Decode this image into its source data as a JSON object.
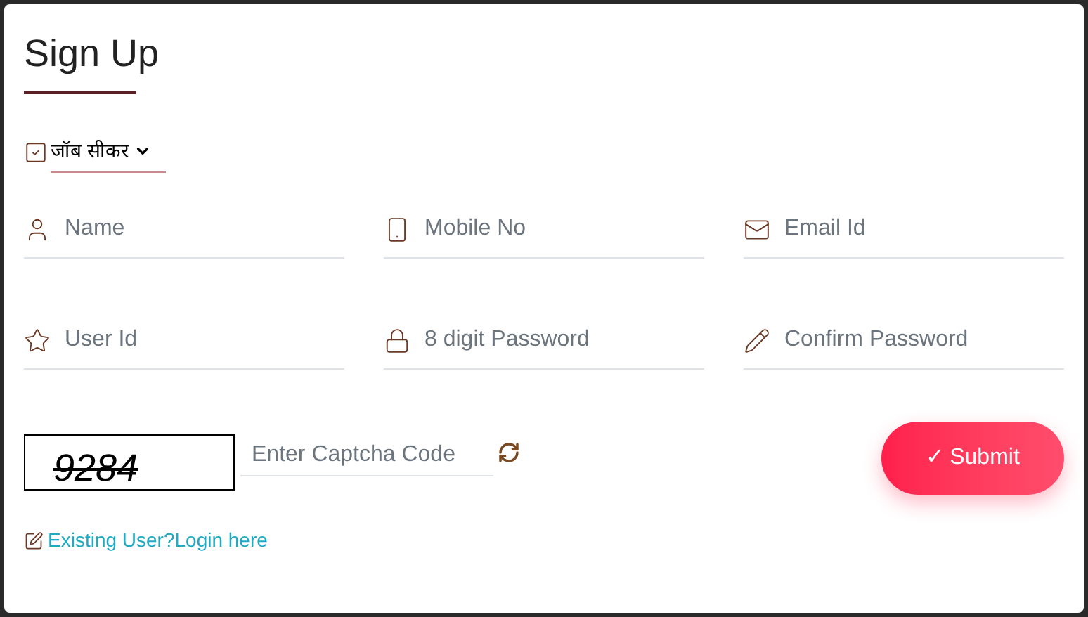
{
  "title": "Sign Up",
  "role_select": {
    "value": "जॉब सीकर"
  },
  "fields": [
    {
      "kind": "person",
      "placeholder": "Name"
    },
    {
      "kind": "phone",
      "placeholder": "Mobile No"
    },
    {
      "kind": "mail",
      "placeholder": "Email Id"
    },
    {
      "kind": "star",
      "placeholder": "User Id"
    },
    {
      "kind": "lock",
      "placeholder": "8 digit Password"
    },
    {
      "kind": "pencil",
      "placeholder": "Confirm Password"
    }
  ],
  "captcha": {
    "code": "9284",
    "placeholder": "Enter Captcha Code"
  },
  "submit": {
    "icon": "✓",
    "label": "Submit"
  },
  "login_link": "Existing User?Login here"
}
